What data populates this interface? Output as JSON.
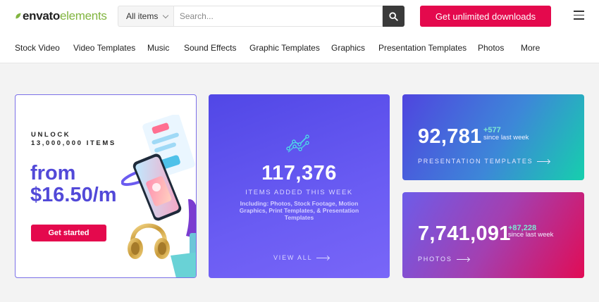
{
  "header": {
    "logo_bold": "envato",
    "logo_light": "elements",
    "category_select": "All items",
    "search_placeholder": "Search...",
    "cta_label": "Get unlimited downloads"
  },
  "nav": {
    "items": [
      "Stock Video",
      "Video Templates",
      "Music",
      "Sound Effects",
      "Graphic Templates",
      "Graphics",
      "Presentation Templates",
      "Photos",
      "More"
    ]
  },
  "promo": {
    "unlock_line1": "UNLOCK",
    "unlock_line2": "13,000,000 ITEMS",
    "price_line1": "from",
    "price_line2": "$16.50/m",
    "button": "Get started"
  },
  "weekly": {
    "count": "117,376",
    "label": "ITEMS ADDED THIS WEEK",
    "description": "Including: Photos, Stock Footage, Motion Graphics, Print Templates, & Presentation Templates",
    "link": "VIEW ALL"
  },
  "stats": [
    {
      "count": "92,781",
      "delta": "+577",
      "since": "since last week",
      "link": "PRESENTATION TEMPLATES"
    },
    {
      "count": "7,741,091",
      "delta": "+87,228",
      "since": "since last week",
      "link": "PHOTOS"
    }
  ],
  "colors": {
    "brand_green": "#82b541",
    "accent_red": "#e4094d",
    "purple": "#5249d8",
    "teal_delta": "#7de8d3"
  },
  "icons": [
    "search-icon",
    "chevron-down-icon",
    "hamburger-menu-icon",
    "trend-chart-icon",
    "arrow-right-icon"
  ]
}
